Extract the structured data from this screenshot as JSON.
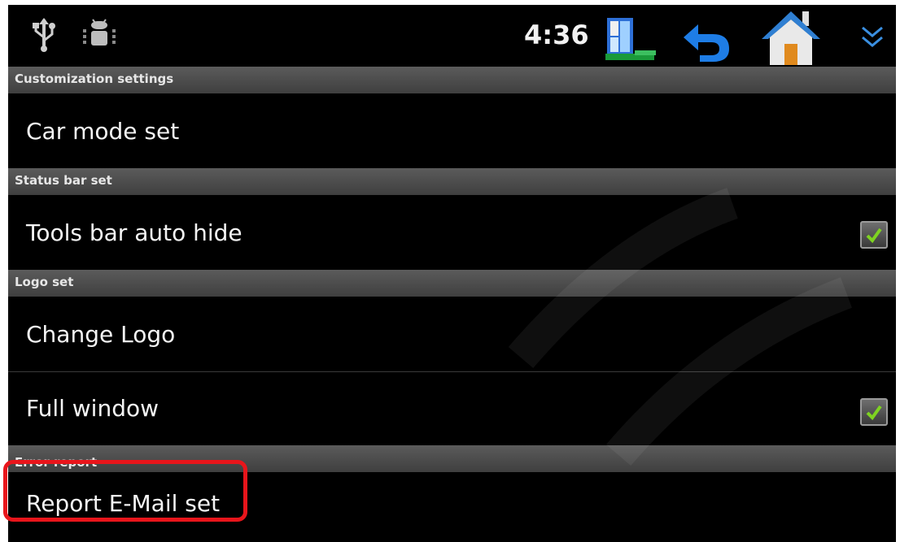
{
  "status_bar": {
    "time": "4:36",
    "icons": [
      "usb-icon",
      "android-debug-icon",
      "toolbox-icon",
      "back-icon",
      "home-icon",
      "collapse-icon"
    ]
  },
  "sections": [
    {
      "title": "Customization settings"
    },
    {
      "title": "Status bar set"
    },
    {
      "title": "Logo set"
    },
    {
      "title": "Error report"
    }
  ],
  "items": [
    {
      "label": "Car mode set"
    },
    {
      "label": "Tools bar auto hide",
      "checked": true
    },
    {
      "label": "Change Logo"
    },
    {
      "label": "Full window",
      "checked": true
    },
    {
      "label": "Report E-Mail set"
    }
  ],
  "colors": {
    "checkmark": "#7ed321",
    "highlight": "#e8151b"
  }
}
